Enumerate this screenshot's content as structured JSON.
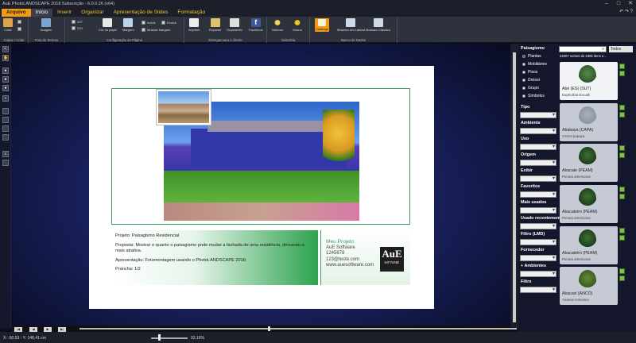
{
  "app": {
    "title": "AuE PhotoLANDSCAPE 2018 Subscrição - 6.0.0.26 (x64)",
    "window_controls": [
      "–",
      "□",
      "✕"
    ]
  },
  "menu": {
    "file": "Arquivo",
    "tabs": [
      "Início",
      "Inserir",
      "Organizar",
      "Apresentação de Slides",
      "Formatação"
    ],
    "right_icons": "↶ ↷ ?"
  },
  "ribbon": {
    "groups": [
      "Copiar / Colar",
      "Foto do Terreno",
      "Configuração da Página",
      "Entregar para o cliente",
      "Noite/Dia",
      "Banco de Dados"
    ],
    "buttons": {
      "colar": "Colar",
      "imagem": "Imagem",
      "cor_papel": "Cor do papel",
      "margem": "Margem",
      "incluir": "Incluir",
      "excluir": "Excluir",
      "mostrar_margem": "Mostrar Margem",
      "imprimir": "Imprimir",
      "exportar": "Exportar",
      "orcamento": "Orçamento",
      "facebook": "Facebook",
      "noturno": "Noturno",
      "diurno": "Diurno",
      "catalogo": "Catálogo",
      "mosaico_lateral": "Mosaico em Lateral",
      "mosaico_classico": "Mosaico Clássico"
    },
    "spin_a": "297",
    "spin_b": "210"
  },
  "page": {
    "desc": {
      "project": "Projeto: Paisagismo Residencial",
      "proposal": "Proposta: Mostrar o quanto o paisagismo pode mudar a fachada de uma residência, deixando-a mais atrativa.",
      "presentation": "Apresentação: Fotomontagem usando o PhotoLANDSCAPE 2018.",
      "board": "Prancha: 1/2"
    },
    "brand": {
      "line1": "Meu Projeto",
      "line2": "AuE Software",
      "line3": "1245678",
      "line4": "123@teste.com",
      "line5": "www.auesoftware.com"
    },
    "logo": {
      "mark": "AuE",
      "word": "SOFTWARE"
    }
  },
  "status": {
    "coords": "X: -50,53 - Y: 148,41 cm",
    "zoom": "93,16%"
  },
  "nav": {
    "first": "|◀",
    "prev": "◀",
    "next": "▶",
    "last": "▶|"
  },
  "panel": {
    "search": {
      "placeholder": ""
    },
    "filter": "Todos",
    "count": "22007 nomes de 2305 itens e...",
    "category_title": "Paisagismo",
    "categories": [
      "Plantas",
      "Mobiliários",
      "Pisos",
      "Divisor",
      "Grupo",
      "Símbolos"
    ],
    "filters": [
      "Tipo",
      "Ambiente",
      "Uso",
      "Origem",
      "Exibir",
      "Favoritos",
      "Mais usados",
      "Usado recentemente",
      "Filtro (LMD)",
      "Fornecedor",
      "+ Ambientes",
      "Filtro"
    ],
    "cards": [
      {
        "name": "Abé (ES) (SUT)",
        "sci": "Euphorbia tirucalli"
      },
      {
        "name": "Ababaya (CAPA)",
        "sci": "Carica papaya"
      },
      {
        "name": "Abacate (PEAM)",
        "sci": "Persea americana"
      },
      {
        "name": "Abacateiro (PEAM)",
        "sci": "Persea americana"
      },
      {
        "name": "Abacatelro (PEAM)",
        "sci": "Persea americana"
      },
      {
        "name": "Abacaxi (ANCO)",
        "sci": "Ananas comosus"
      }
    ]
  },
  "colors": {
    "accent": "#f39c12",
    "brand_green": "#3aa05a",
    "menu_text": "#f1c232"
  }
}
